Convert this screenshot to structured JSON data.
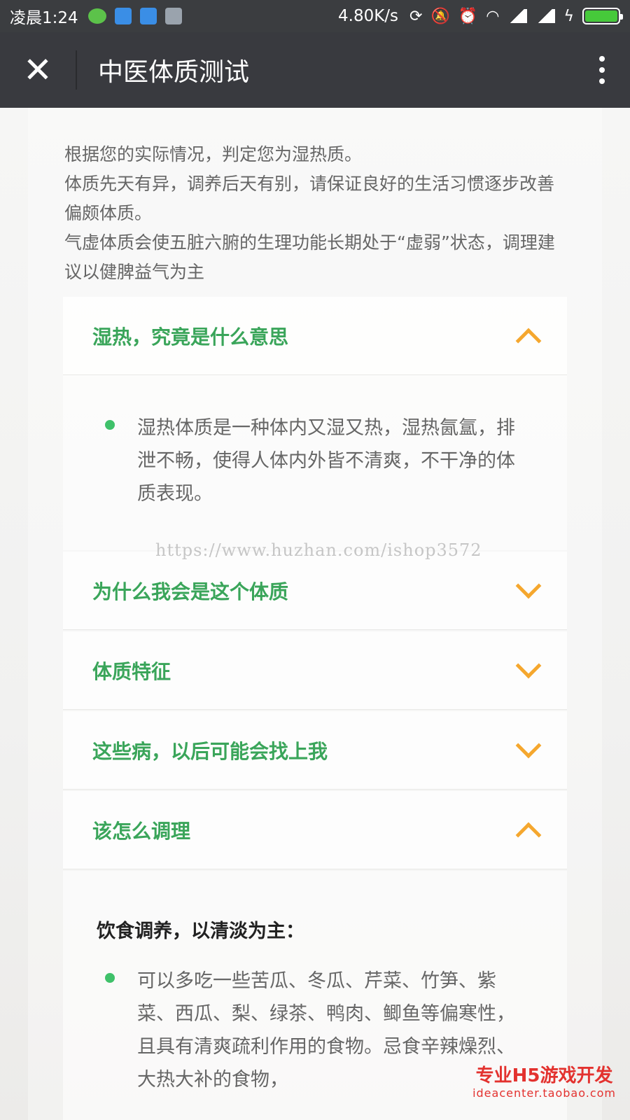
{
  "status_bar": {
    "time": "凌晨1:24",
    "network_speed": "4.80K/s"
  },
  "nav": {
    "close_label": "✕",
    "title": "中医体质测试"
  },
  "intro": {
    "line1": "根据您的实际情况，判定您为湿热质。",
    "line2": "体质先天有异，调养后天有别，请保证良好的生活习惯逐步改善偏颇体质。",
    "line3": "气虚体质会使五脏六腑的生理功能长期处于“虚弱”状态，调理建议以健脾益气为主"
  },
  "accordion": [
    {
      "title": "湿热，究竟是什么意思",
      "expanded": true,
      "content": "湿热体质是一种体内又湿又热，湿热氤氲，排泄不畅，使得人体内外皆不清爽，不干净的体质表现。"
    },
    {
      "title": "为什么我会是这个体质",
      "expanded": false
    },
    {
      "title": "体质特征",
      "expanded": false
    },
    {
      "title": "这些病，以后可能会找上我",
      "expanded": false
    },
    {
      "title": "该怎么调理",
      "expanded": true
    }
  ],
  "regimen": {
    "diet_heading": "饮食调养，以清淡为主：",
    "diet_text": "可以多吃一些苦瓜、冬瓜、芹菜、竹笋、紫菜、西瓜、梨、绿茶、鸭肉、鲫鱼等偏寒性，且具有清爽疏利作用的食物。忌食辛辣燥烈、大热大补的食物，"
  },
  "watermarks": {
    "url": "https://www.huzhan.com/ishop3572",
    "promo_main": "专业H5游戏开发",
    "promo_sub": "ideacenter.taobao.com"
  },
  "colors": {
    "accent_green": "#3aa55a",
    "chevron_orange": "#f5a72e",
    "nav_bg": "#393a3f"
  }
}
